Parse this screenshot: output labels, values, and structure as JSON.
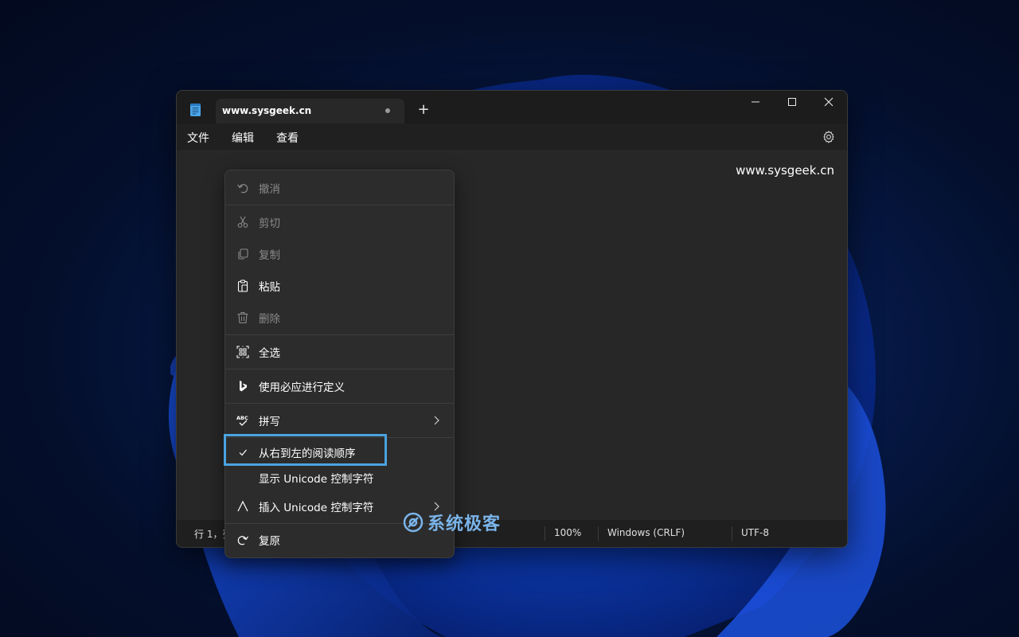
{
  "tab": {
    "title": "www.sysgeek.cn",
    "new_tab": "+"
  },
  "menubar": {
    "file": "文件",
    "edit": "编辑",
    "view": "查看"
  },
  "editor": {
    "content": "www.sysgeek.cn"
  },
  "statusbar": {
    "position": "行 1，列",
    "zoom": "100%",
    "line_ending": "Windows (CRLF)",
    "encoding": "UTF-8"
  },
  "context_menu": {
    "undo": "撤消",
    "cut": "剪切",
    "copy": "复制",
    "paste": "粘贴",
    "delete": "删除",
    "select_all": "全选",
    "define_bing": "使用必应进行定义",
    "spelling": "拼写",
    "rtl": "从右到左的阅读顺序",
    "show_unicode": "显示 Unicode 控制字符",
    "insert_unicode": "插入 Unicode 控制字符",
    "redo": "复原"
  },
  "watermark": {
    "text": "系统极客"
  },
  "colors": {
    "accent": "#4aa3e0",
    "bg": "#272727",
    "menu_bg": "#2c2c2c"
  }
}
